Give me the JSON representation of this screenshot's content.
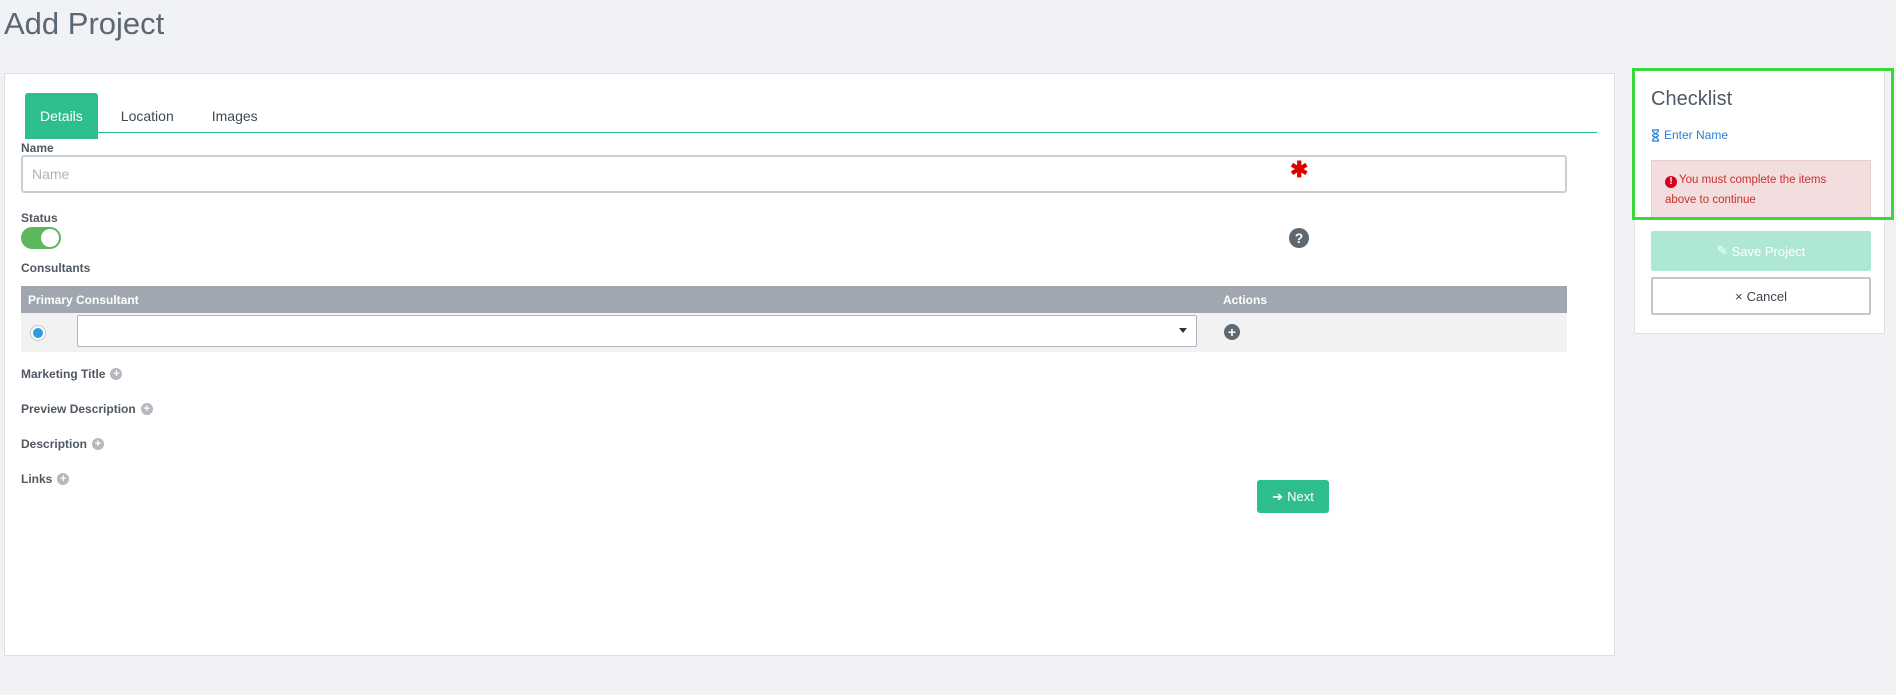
{
  "page": {
    "title": "Add Project"
  },
  "tabs": [
    {
      "label": "Details",
      "active": true
    },
    {
      "label": "Location",
      "active": false
    },
    {
      "label": "Images",
      "active": false
    }
  ],
  "form": {
    "name_label": "Name",
    "name_placeholder": "Name",
    "name_value": "",
    "required_mark": "✱",
    "status_label": "Status",
    "status_on": true,
    "consultants_label": "Consultants",
    "table_headers": {
      "primary": "Primary",
      "consultant": "Consultant",
      "actions": "Actions"
    },
    "consultant_selected": "",
    "expanders": [
      {
        "label": "Marketing Title"
      },
      {
        "label": "Preview Description"
      },
      {
        "label": "Description"
      },
      {
        "label": "Links"
      }
    ],
    "next_label": "Next"
  },
  "checklist": {
    "title": "Checklist",
    "items": [
      {
        "label": "Enter Name",
        "icon": "hourglass-icon"
      }
    ],
    "alert_text": "You must complete the items above to continue",
    "save_label": "Save Project",
    "cancel_label": "Cancel"
  },
  "colors": {
    "accent": "#2dbd8e",
    "toggle": "#5cb85c",
    "required": "#e00000",
    "alert_bg": "#f2dede",
    "alert_text": "#c9302c",
    "highlight": "#3ad83a",
    "link": "#2a7fd5"
  }
}
